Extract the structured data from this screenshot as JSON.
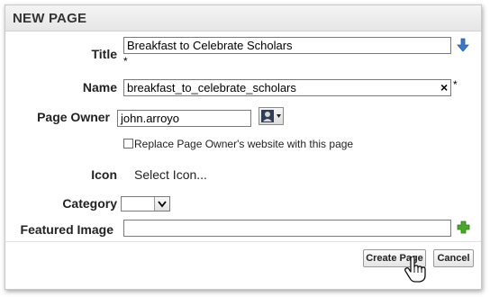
{
  "dialog": {
    "title": "NEW PAGE"
  },
  "form": {
    "title": {
      "label": "Title",
      "value": "Breakfast to Celebrate Scholars",
      "required_marker": "*"
    },
    "name": {
      "label": "Name",
      "value": "breakfast_to_celebrate_scholars",
      "clear_glyph": "×",
      "required_marker": "*"
    },
    "page_owner": {
      "label": "Page Owner",
      "value": "john.arroyo"
    },
    "replace_checkbox": {
      "label": "Replace Page Owner's website with this page",
      "checked": false
    },
    "icon": {
      "label": "Icon",
      "select_text": "Select Icon..."
    },
    "category": {
      "label": "Category",
      "selected": ""
    },
    "featured_image": {
      "label": "Featured Image",
      "value": ""
    }
  },
  "buttons": {
    "create": "Create Page",
    "cancel": "Cancel"
  },
  "colors": {
    "arrow_blue": "#3a78c8",
    "plus_green": "#4aa62e"
  },
  "icons": {
    "title_action": "down-arrow-icon",
    "owner_picker": "user-picker-icon",
    "featured_add": "plus-icon",
    "cursor": "hand-pointer-icon"
  }
}
